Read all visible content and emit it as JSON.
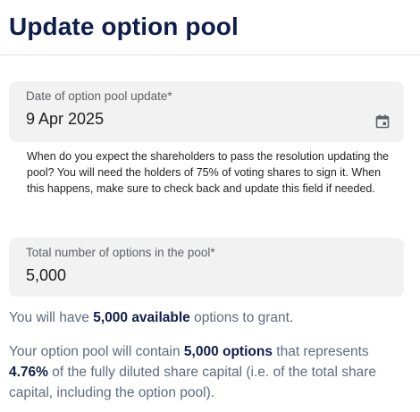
{
  "header": {
    "title": "Update option pool"
  },
  "date_field": {
    "label": "Date of option pool update*",
    "value": "9 Apr 2025",
    "icon": "calendar-icon",
    "helper_text": "When do you expect the shareholders to pass the resolution updating the pool? You will need the holders of 75% of voting shares to sign it. When this happens, make sure to check back and update this field if needed."
  },
  "total_field": {
    "label": "Total number of options in the pool*",
    "value": "5,000"
  },
  "summary": {
    "available_prefix": "You will have ",
    "available_value": "5,000 available",
    "available_suffix": " options to grant.",
    "contain_prefix": "Your option pool will contain ",
    "contain_value": "5,000 options",
    "contain_middle": " that represents ",
    "percent_value": "4.76%",
    "contain_suffix": " of the fully diluted share capital (i.e. of the total share capital, including the option pool)."
  },
  "colors": {
    "title": "#0f1d4a",
    "field_bg": "#f2f2f2",
    "info_text": "#5f6b80",
    "emphasis": "#0f1d4a"
  }
}
